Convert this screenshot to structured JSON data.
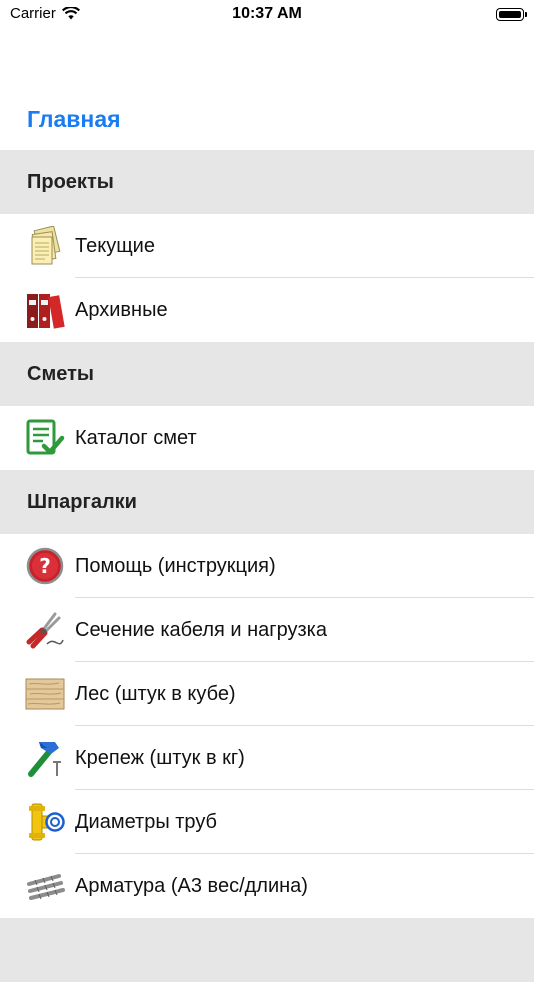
{
  "status": {
    "carrier": "Carrier",
    "time": "10:37 AM"
  },
  "nav": {
    "title": "Главная"
  },
  "sections": {
    "projects": {
      "header": "Проекты",
      "items": [
        {
          "label": "Текущие",
          "icon": "papers-icon"
        },
        {
          "label": "Архивные",
          "icon": "binders-icon"
        }
      ]
    },
    "estimates": {
      "header": "Сметы",
      "items": [
        {
          "label": "Каталог смет",
          "icon": "checklist-icon"
        }
      ]
    },
    "cheatsheets": {
      "header": "Шпаргалки",
      "items": [
        {
          "label": "Помощь (инструкция)",
          "icon": "help-icon"
        },
        {
          "label": "Сечение кабеля и нагрузка",
          "icon": "cable-icon"
        },
        {
          "label": "Лес (штук в кубе)",
          "icon": "wood-icon"
        },
        {
          "label": "Крепеж (штук в кг)",
          "icon": "hammer-icon"
        },
        {
          "label": "Диаметры труб",
          "icon": "pipe-icon"
        },
        {
          "label": "Арматура (А3 вес/длина)",
          "icon": "rebar-icon"
        }
      ]
    },
    "next": {
      "header": ""
    }
  }
}
